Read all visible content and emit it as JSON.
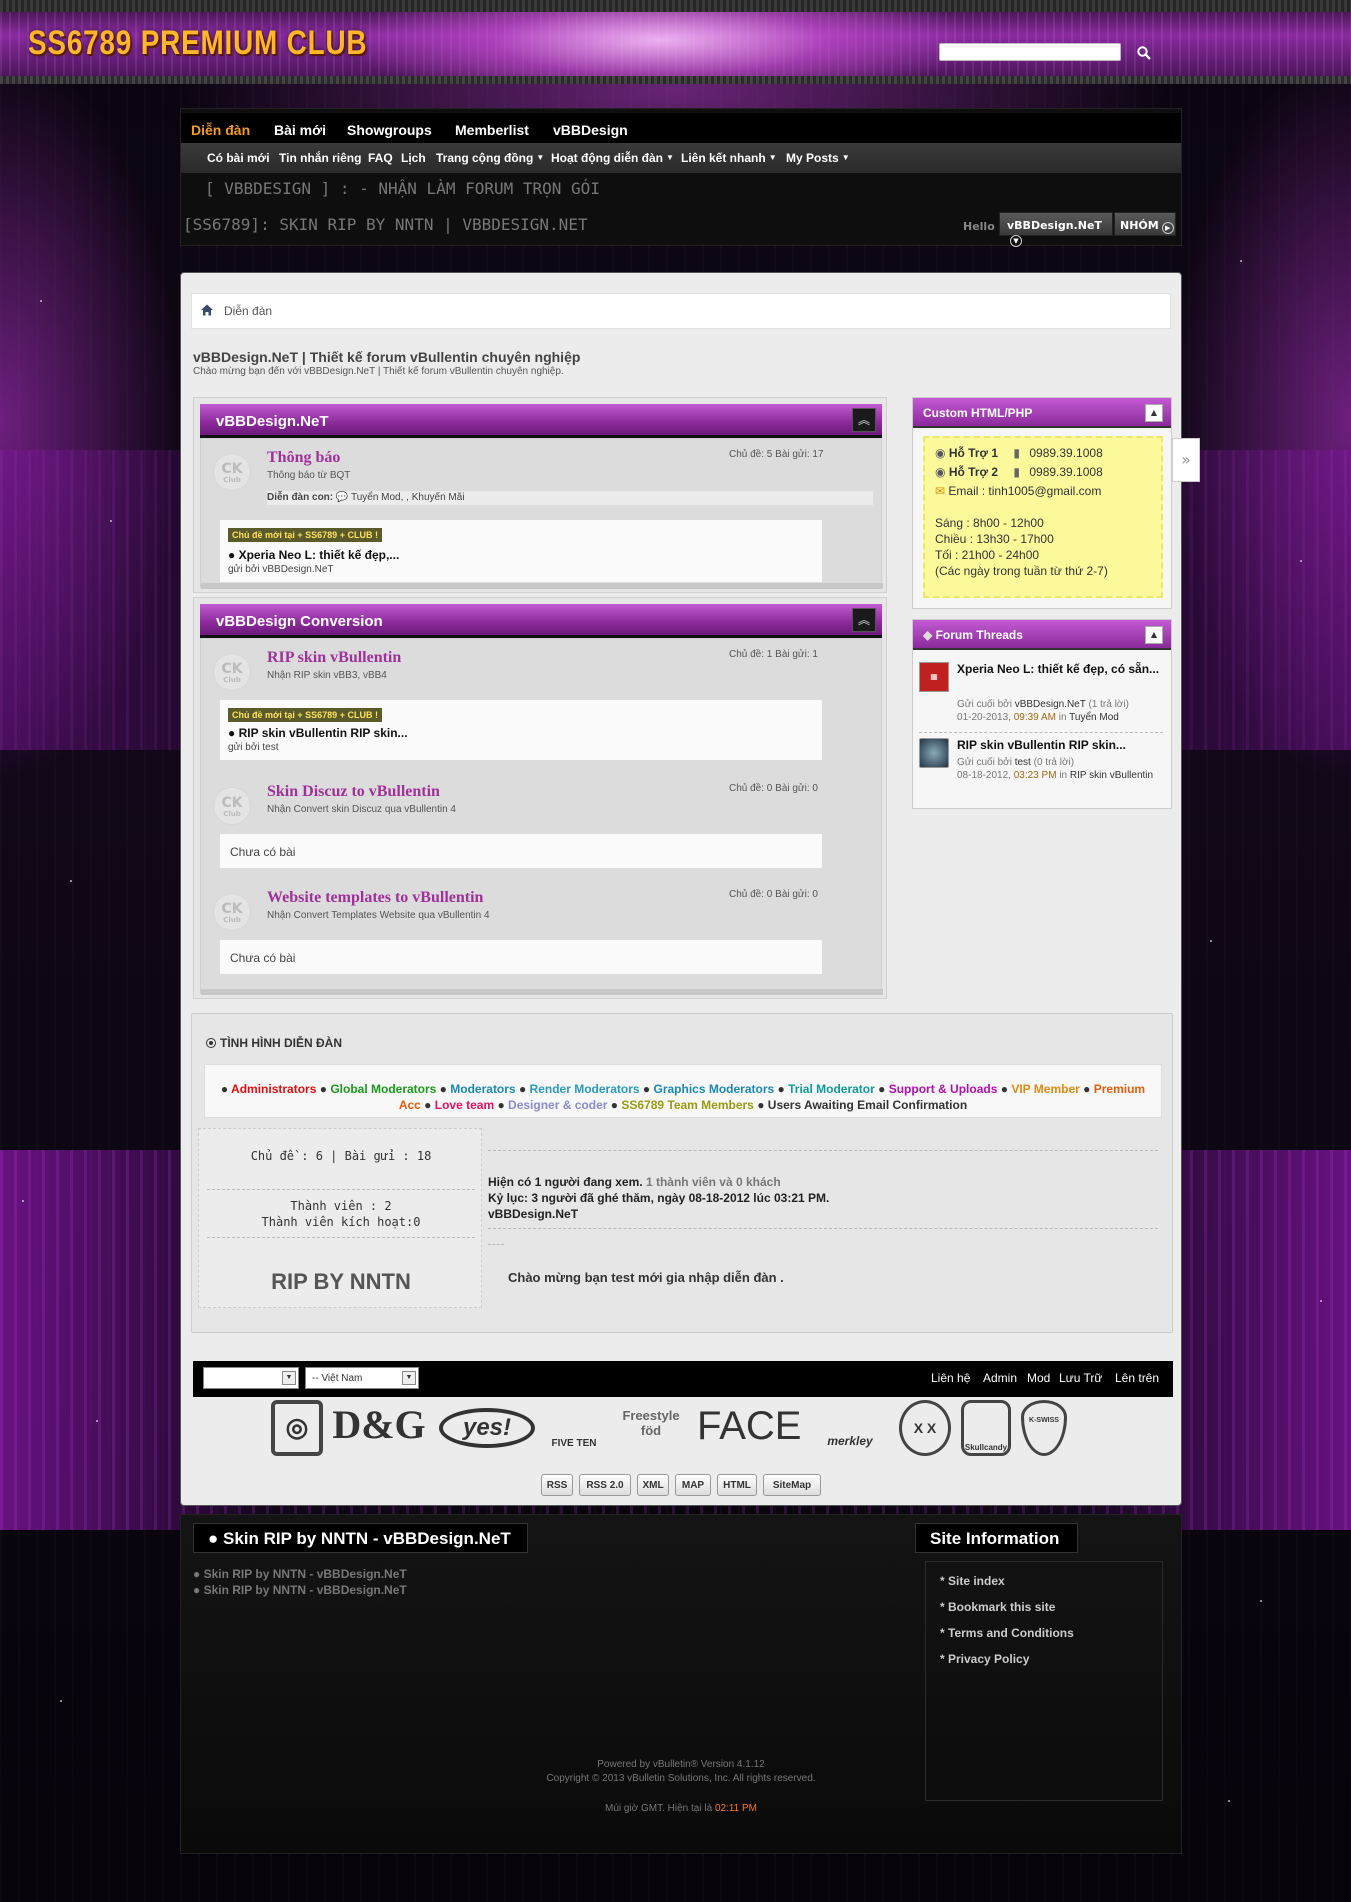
{
  "site": {
    "logo": "SS6789 PREMIUM CLUB",
    "search_placeholder": ""
  },
  "nav": {
    "tabs": [
      "Diễn đàn",
      "Bài mới",
      "Showgroups",
      "Memberlist",
      "vBBDesign"
    ],
    "subnav": [
      "Có bài mới",
      "Tin nhắn riêng",
      "FAQ",
      "Lịch",
      "Trang cộng đồng",
      "Hoạt động diễn đàn",
      "Liên kết nhanh",
      "My Posts"
    ],
    "marquee1": "[ VBBDESIGN ] :  - NHẬN LÀM FORUM TRỌN GÓI",
    "marquee2": "[SS6789]: SKIN RIP BY NNTN | VBBDESIGN.NET",
    "hello": "Hello",
    "username": "vBBDesign.NeT",
    "group_btn": "NHÓM"
  },
  "breadcrumb": {
    "home": "Diễn đàn"
  },
  "page": {
    "title": "vBBDesign.NeT | Thiết kế forum vBullentin chuyên nghiệp",
    "description": "Chào mừng bạn đến với vBBDesign.NeT | Thiết kế forum vBullentin chuyên nghiệp."
  },
  "categories": [
    {
      "title": "vBBDesign.NeT",
      "forums": [
        {
          "name": "Thông báo",
          "desc": "Thông báo từ BQT",
          "stats": "Chủ đề: 5   Bài gửi: 17",
          "subforums_label": "Diễn đàn con:",
          "subforums": "Tuyển Mod, ,   Khuyến Mãi",
          "newtag": "Chủ đề mới tại + SS6789 + CLUB !",
          "last_title": "Xperia Neo L: thiết kế đẹp,...",
          "last_by": "gửi bởi vBBDesign.NeT"
        }
      ]
    },
    {
      "title": "vBBDesign Conversion",
      "forums": [
        {
          "name": "RIP skin vBullentin",
          "desc": "Nhận RIP skin vBB3, vBB4",
          "stats": "Chủ đề: 1   Bài gửi: 1",
          "newtag": "Chủ đề mới tại + SS6789 + CLUB !",
          "last_title": "RIP skin vBullentin RIP skin...",
          "last_by": "gửi bởi test"
        },
        {
          "name": "Skin Discuz to vBullentin",
          "desc": "Nhận Convert skin Discuz qua vBullentin 4",
          "stats": "Chủ đề: 0   Bài gửi: 0",
          "empty": "Chưa có bài"
        },
        {
          "name": "Website templates to vBullentin",
          "desc": "Nhận Convert Templates Website qua vBullentin 4",
          "stats": "Chủ đề: 0   Bài gửi: 0",
          "empty": "Chưa có bài"
        }
      ]
    }
  ],
  "sidebar": {
    "custom": {
      "title": "Custom HTML/PHP",
      "support1_label": "Hỗ Trợ 1",
      "support1_phone": "0989.39.1008",
      "support2_label": "Hỗ Trợ 2",
      "support2_phone": "0989.39.1008",
      "email": "Email : tinh1005@gmail.com",
      "hours1": "Sáng : 8h00 - 12h00",
      "hours2": "Chiều : 13h30 - 17h00",
      "hours3": "Tối : 21h00 - 24h00",
      "hours4": "(Các ngày trong tuần từ thứ 2-7)"
    },
    "threads": {
      "title": "Forum Threads",
      "items": [
        {
          "title": "Xperia Neo L: thiết kế đẹp, có sẵn...",
          "by_label": "Gửi cuối bởi",
          "by": "vBBDesign.NeT",
          "replies": "(1 trả lời)",
          "date": "01-20-2013,",
          "time": "09:39 AM",
          "in": "in",
          "forum": "Tuyển Mod"
        },
        {
          "title": "RIP skin vBullentin RIP skin...",
          "by_label": "Gửi cuối bởi",
          "by": "test",
          "replies": "(0 trả lời)",
          "date": "08-18-2012,",
          "time": "03:23 PM",
          "in": "in",
          "forum": "RIP skin vBullentin"
        }
      ]
    }
  },
  "status": {
    "title": "TÌNH HÌNH DIỄN ĐÀN",
    "groups": [
      {
        "name": "Administrators",
        "color": "#e01010"
      },
      {
        "name": "Global Moderators",
        "color": "#1a9a1a"
      },
      {
        "name": "Moderators",
        "color": "#1a8ab0"
      },
      {
        "name": "Render Moderators",
        "color": "#2a9ac0"
      },
      {
        "name": "Graphics Moderators",
        "color": "#1a8ab0"
      },
      {
        "name": "Trial Moderator",
        "color": "#109a9a"
      },
      {
        "name": "Support & Uploads",
        "color": "#b010b0"
      },
      {
        "name": "VIP Member",
        "color": "#e08a10"
      },
      {
        "name": "Premium Acc",
        "color": "#e06010"
      },
      {
        "name": "Love team",
        "color": "#e01060"
      },
      {
        "name": "Designer & coder",
        "color": "#8a8ad0"
      },
      {
        "name": "SS6789 Team Members",
        "color": "#9a9a10"
      },
      {
        "name": "Users Awaiting Email Confirmation",
        "color": "#333333"
      }
    ],
    "stats_line": "Chủ đề : 6 | Bài gửi : 18",
    "members": "Thành viên : 2",
    "active_members": "Thành viên kích hoạt:0",
    "rip": "RIP BY NNTN",
    "online_a": "Hiện có 1 người đang xem.",
    "online_b": "1 thành viên và 0 khách",
    "record": "Kỷ lục: 3 người đã ghé thăm, ngày 08-18-2012 lúc 03:21 PM.",
    "online_user": "vBBDesign.NeT",
    "welcome": "Chào mừng bạn test mới gia nhập diễn đàn ."
  },
  "footbar": {
    "style_select": "",
    "lang_select": "-- Việt Nam",
    "links": [
      "Liên hệ",
      "Admin",
      "Mod",
      "Lưu Trữ",
      "Lên trên"
    ]
  },
  "brands": [
    "D&G",
    "yes!",
    "FIVE TEN",
    "Freestyle föd",
    "FACE",
    "merkley",
    "X X",
    "Skullcandy",
    "K-SWISS"
  ],
  "rss": [
    "RSS",
    "RSS 2.0",
    "XML",
    "MAP",
    "HTML",
    "SiteMap"
  ],
  "darkfoot": {
    "title": "● Skin RIP by NNTN - vBBDesign.NeT",
    "link1": "● Skin RIP by NNTN - vBBDesign.NeT",
    "link2": "● Skin RIP by NNTN - vBBDesign.NeT",
    "site_info_title": "Site Information",
    "site_links": [
      "* Site index",
      "* Bookmark this site",
      "* Terms and Conditions",
      "* Privacy Policy"
    ],
    "powered": "Powered by vBulletin® Version 4.1.12",
    "copyright": "Copyright © 2013 vBulletin Solutions, Inc. All rights reserved.",
    "tz_text": "Múi giờ GMT. Hiện tại là",
    "tz_time": "02:11 PM"
  }
}
